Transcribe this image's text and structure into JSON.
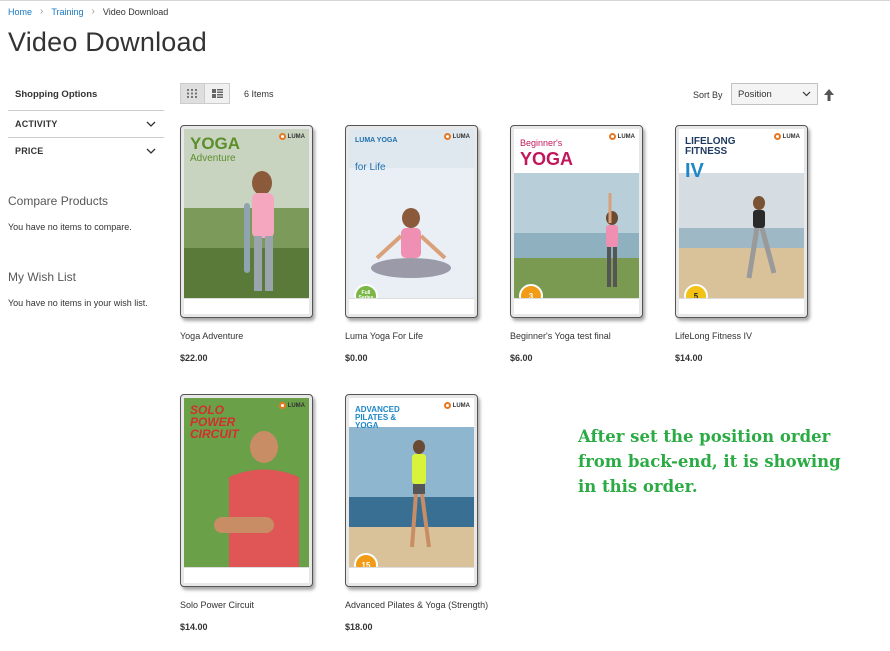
{
  "breadcrumb": {
    "home": "Home",
    "training": "Training",
    "current": "Video Download",
    "separator": "›"
  },
  "page_title": "Video Download",
  "sidebar": {
    "shopping_options": "Shopping Options",
    "filters": [
      {
        "label": "ACTIVITY"
      },
      {
        "label": "PRICE"
      }
    ],
    "compare_title": "Compare Products",
    "compare_text": "You have no items to compare.",
    "wishlist_title": "My Wish List",
    "wishlist_text": "You have no items in your wish list."
  },
  "toolbar": {
    "items_count": "6 Items",
    "sort_label": "Sort By",
    "sort_value": "Position"
  },
  "products": [
    {
      "name": "Yoga Adventure",
      "price": "$22.00",
      "cover_title": "YOGA",
      "cover_sub": "Adventure",
      "title_color": "#5a8f2a",
      "bg": "#c9d4c0",
      "badge": ""
    },
    {
      "name": "Luma Yoga For Life",
      "price": "$0.00",
      "cover_title": "LUMA YOGA",
      "cover_sub": "for Life",
      "title_color": "#1e6fae",
      "bg": "#dfe8ef",
      "badge": "Full Series",
      "badge_color": "#7ab648"
    },
    {
      "name": "Beginner's Yoga test final",
      "price": "$6.00",
      "cover_title": "YOGA",
      "cover_sub": "Beginner's",
      "title_color": "#c2185b",
      "bg": "#b8cfd9",
      "badge": "3",
      "badge_color": "#f29b16"
    },
    {
      "name": "LifeLong Fitness IV",
      "price": "$14.00",
      "cover_title": "LIFELONG FITNESS",
      "cover_sub": "IV",
      "title_color": "#1e3a5f",
      "bg": "#d6dde2",
      "badge": "5",
      "badge_color": "#f2c316"
    },
    {
      "name": "Solo Power Circuit",
      "price": "$14.00",
      "cover_title": "SOLO POWER CIRCUIT",
      "cover_sub": "",
      "title_color": "#d32f2f",
      "bg": "#6aa048",
      "badge": ""
    },
    {
      "name": "Advanced Pilates & Yoga (Strength)",
      "price": "$18.00",
      "cover_title": "ADVANCED PILATES & YOGA",
      "cover_sub": "",
      "title_color": "#1e88c7",
      "bg": "#8fb6cf",
      "badge": "15",
      "badge_color": "#f29b16"
    }
  ],
  "annotation": "After set the position order from back-end, it is showing in this order.",
  "colors": {
    "link": "#1979c3",
    "annotation": "#2bab44"
  }
}
